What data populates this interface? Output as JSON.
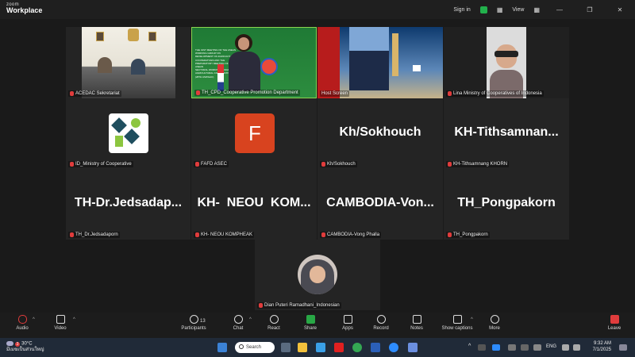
{
  "titlebar": {
    "app_line1": "zoom",
    "app_line2": "Workplace",
    "sign_in": "Sign in",
    "view": "View"
  },
  "tiles": [
    {
      "name": "ACEDAC Sekretariat",
      "type": "video"
    },
    {
      "name": "TH_CPD_Cooperative Promotion Department",
      "type": "video"
    },
    {
      "name": "Host Screen",
      "type": "video"
    },
    {
      "name": "Lina Ministry of Cooperatives of Indonesia",
      "type": "video"
    },
    {
      "name": "ID_Ministry of Cooperative",
      "type": "logo"
    },
    {
      "name": "FAFD ASEC",
      "type": "initial",
      "initial": "F"
    },
    {
      "name": "Kh/Sokhouch",
      "display": "Kh/Sokhouch",
      "type": "name"
    },
    {
      "name": "KH-Tithsamnang KHORN",
      "display": "KH-Tithsamnan...",
      "type": "name"
    },
    {
      "name": "TH_Dr.Jedsadaporn",
      "display": "TH-Dr.Jedsadap...",
      "type": "name"
    },
    {
      "name": "KH- NEOU KOMPHEAK",
      "display": "KH-  NEOU  KOM...",
      "type": "name"
    },
    {
      "name": "CAMBODIA-Vong Phalla",
      "display": "CAMBODIA-Von...",
      "type": "name"
    },
    {
      "name": "TH_Pongpakorn",
      "display": "TH_Pongpakorn",
      "type": "name"
    },
    {
      "name": "Dian Puteri Ramadhani_Indonesian",
      "type": "avatar"
    }
  ],
  "slide_text": {
    "l1": "THE 31ST MEETING OF THE ASEAN WORKING GROUP ON DEVELOPMENT OF AGRICULTURAL",
    "l2": "COOPERATIVES AND THE PREPARATORY MEETING OF THE ASEAN",
    "l3": "SECTORAL WORKING GROUP ON AGRICULTURAL COOPERATIVES (28TH ASWGAC)"
  },
  "toolbar": {
    "audio": "Audio",
    "video": "Video",
    "participants": "Participants",
    "participants_count": "13",
    "chat": "Chat",
    "react": "React",
    "share": "Share",
    "apps": "Apps",
    "record": "Record",
    "notes": "Notes",
    "captions": "Show captions",
    "more": "More",
    "leave": "Leave"
  },
  "taskbar": {
    "temp": "30°C",
    "weather_desc": "มีเมฆเป็นส่วนใหญ่",
    "search": "Search",
    "lang": "ENG",
    "time": "9:32 AM",
    "date": "7/1/2025",
    "badge": "3"
  },
  "colors": {
    "share_green": "#28a745",
    "leave_red": "#e03c3c",
    "fafd_orange": "#d8431f"
  }
}
